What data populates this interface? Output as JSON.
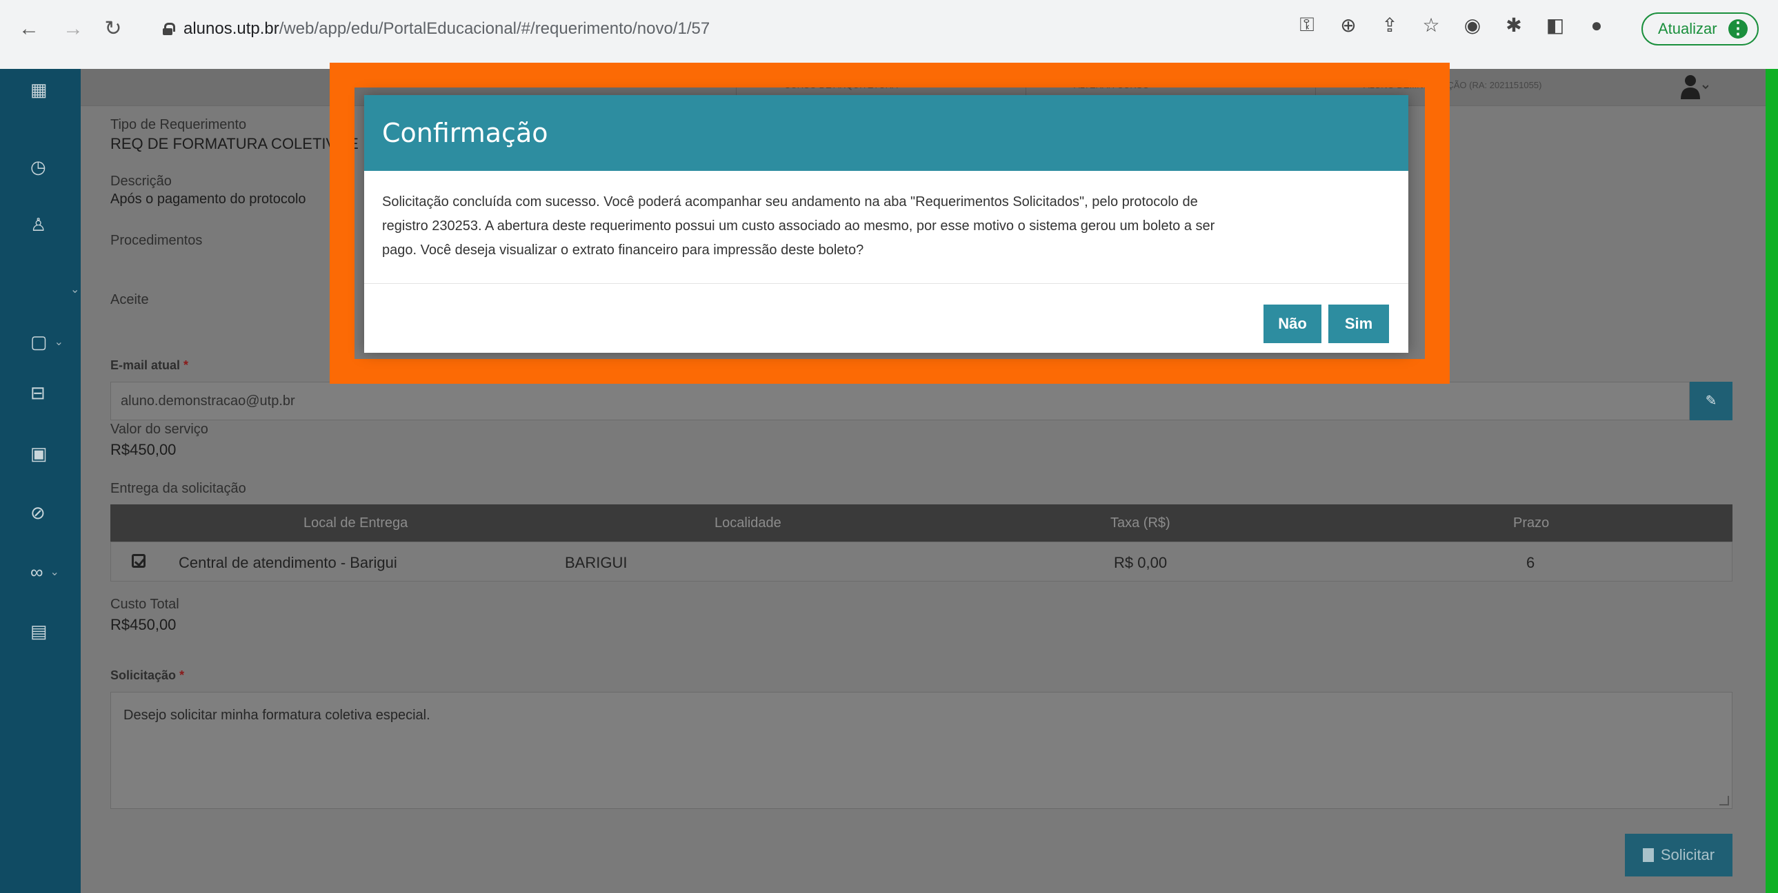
{
  "browser": {
    "url_host": "alunos.utp.br",
    "url_path": "/web/app/edu/PortalEducacional/#/requerimento/novo/1/57",
    "update_label": "Atualizar",
    "menu_icon": "⋮"
  },
  "topbar": {
    "item1": "CURSO DE ARQUITETURA",
    "item2": "ALTERAR CURSO",
    "item3": "ALUNO DE...NSTRAÇÃO (RA: 2021151055)"
  },
  "form": {
    "tipo_label": "Tipo de Requerimento",
    "tipo_value": "REQ DE FORMATURA COLETIVA E",
    "descricao_label": "Descrição",
    "descricao_value": "Após o pagamento do protocolo",
    "procedimentos_label": "Procedimentos",
    "aceite_label": "Aceite",
    "email_label": "E-mail atual",
    "required_mark": "*",
    "email_value": "aluno.demonstracao@utp.br",
    "valor_label": "Valor do serviço",
    "valor_value": "R$450,00",
    "entrega_label": "Entrega da solicitação",
    "custo_label": "Custo Total",
    "custo_value": "R$450,00",
    "solicitacao_label": "Solicitação",
    "solicitacao_value": "Desejo solicitar minha formatura coletiva especial.",
    "submit_label": "Solicitar"
  },
  "table": {
    "headers": [
      "Local de Entrega",
      "Localidade",
      "Taxa (R$)",
      "Prazo"
    ],
    "rows": [
      {
        "local": "Central de atendimento - Barigui",
        "localidade": "BARIGUI",
        "taxa": "R$ 0,00",
        "prazo": "6",
        "checked": true
      }
    ]
  },
  "modal": {
    "title": "Confirmação",
    "line1": "Solicitação concluída com sucesso. Você poderá acompanhar seu andamento na aba \"Requerimentos Solicitados\", pelo protocolo de",
    "line2": "registro 230253. A abertura deste requerimento possui um custo associado ao mesmo, por esse motivo o sistema gerou um boleto a ser",
    "line3": "pago. Você deseja visualizar o extrato financeiro para impressão deste boleto?",
    "no_label": "Não",
    "yes_label": "Sim"
  },
  "colors": {
    "frame_green": "#0fb025",
    "highlight_orange": "#fc6a05",
    "modal_teal": "#2d8da0",
    "sidebar": "#104b63"
  }
}
